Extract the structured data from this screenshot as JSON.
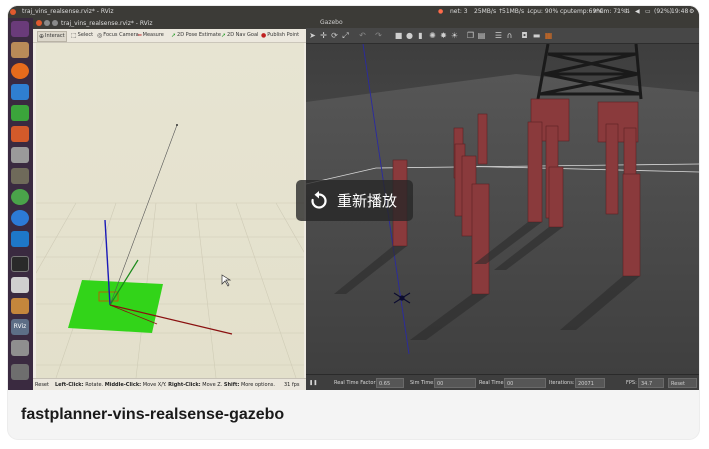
{
  "topbar": {
    "window_title": "traj_vins_realsense.rviz* - RViz",
    "status": [
      "net: 3",
      "25MB/s ↑",
      "51MB/s ↓",
      "cpu: 90%",
      "cputemp:69°C",
      "mem: 71%",
      "(92%)",
      "19:48"
    ]
  },
  "launcher": {
    "icons": [
      "ubuntu-logo-icon",
      "files-icon",
      "firefox-icon",
      "writer-icon",
      "calc-icon",
      "impress-icon",
      "settings-icon",
      "gimp-icon",
      "chromium-icon",
      "media-icon",
      "vscode-icon",
      "terminal-icon",
      "text-editor-icon",
      "package-icon",
      "rviz-icon",
      "cd-drive-icon",
      "trash-icon"
    ],
    "rviz_label": "RViz"
  },
  "rviz": {
    "title": "traj_vins_realsense.rviz* - RViz",
    "tools": [
      {
        "icon": "interact-icon",
        "glyph": "⊕",
        "label": "Interact"
      },
      {
        "icon": "select-icon",
        "glyph": "⬚",
        "label": "Select"
      },
      {
        "icon": "focus-camera-icon",
        "glyph": "◎",
        "label": "Focus Camera"
      },
      {
        "icon": "measure-icon",
        "glyph": "━",
        "label": "Measure"
      },
      {
        "icon": "pose-estimate-icon",
        "glyph": "➚",
        "label": "2D Pose Estimate"
      },
      {
        "icon": "nav-goal-icon",
        "glyph": "➚",
        "label": "2D Nav Goal"
      },
      {
        "icon": "publish-point-icon",
        "glyph": "●",
        "label": "Publish Point"
      }
    ],
    "status": {
      "reset": "Reset",
      "left_key": "Left-Click:",
      "left_val": "Rotate.",
      "middle_key": "Middle-Click:",
      "middle_val": "Move X/Y.",
      "right_key": "Right-Click:",
      "right_val": "Move Z.",
      "shift_key": "Shift:",
      "shift_val": "More options.",
      "fps": "31 fps"
    }
  },
  "gazebo": {
    "title": "Gazebo",
    "bottom": {
      "rtf_label": "Real Time Factor:",
      "rtf_value": "0.65",
      "sim_label": "Sim Time:",
      "sim_value": "00 00:01:20.286",
      "real_label": "Real Time:",
      "real_value": "00 00:01:22.918",
      "iter_label": "Iterations:",
      "iter_value": "20071",
      "fps_label": "FPS:",
      "fps_value": "34.7 146",
      "reset": "Reset Time"
    }
  },
  "overlay": {
    "icon": "replay-icon",
    "label": "重新播放"
  },
  "caption": "fastplanner-vins-realsense-gazebo",
  "colors": {
    "rviz_grid_plane": "#32d419",
    "rviz_bg": "#dfdcc6",
    "gz_ground": "#4a4a4a",
    "pillar": "#8a3a3c",
    "overlay_bg": "#262626"
  }
}
